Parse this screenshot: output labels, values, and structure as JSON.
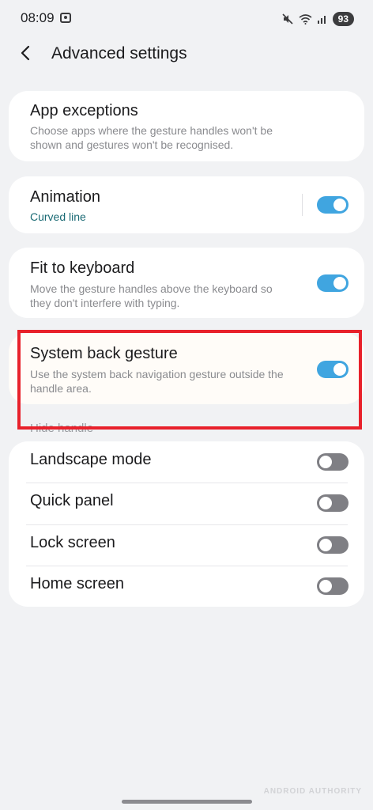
{
  "status_bar": {
    "time": "08:09",
    "battery": "93",
    "icons": [
      "screen-capture-icon",
      "mute-icon",
      "wifi-icon",
      "signal-icon"
    ]
  },
  "header": {
    "title": "Advanced settings",
    "back_icon": "chevron-left-icon"
  },
  "settings": {
    "app_exceptions": {
      "title": "App exceptions",
      "description": "Choose apps where the gesture handles won't be shown and gestures won't be recognised."
    },
    "animation": {
      "title": "Animation",
      "subtitle": "Curved line",
      "enabled": true
    },
    "fit_to_keyboard": {
      "title": "Fit to keyboard",
      "description": "Move the gesture handles above the keyboard so they don't interfere with typing.",
      "enabled": true
    },
    "system_back_gesture": {
      "title": "System back gesture",
      "description": "Use the system back navigation gesture outside the handle area.",
      "enabled": true
    }
  },
  "hide_handle": {
    "header": "Hide handle",
    "items": [
      {
        "label": "Landscape mode",
        "enabled": false
      },
      {
        "label": "Quick panel",
        "enabled": false
      },
      {
        "label": "Lock screen",
        "enabled": false
      },
      {
        "label": "Home screen",
        "enabled": false
      }
    ]
  },
  "watermark": "ANDROID AUTHORITY",
  "colors": {
    "background": "#f1f2f4",
    "card": "#ffffff",
    "toggle_on": "#40a5e0",
    "toggle_off": "#7f7f84",
    "highlight": "#e8212b",
    "accent_text": "#1a6a74"
  }
}
